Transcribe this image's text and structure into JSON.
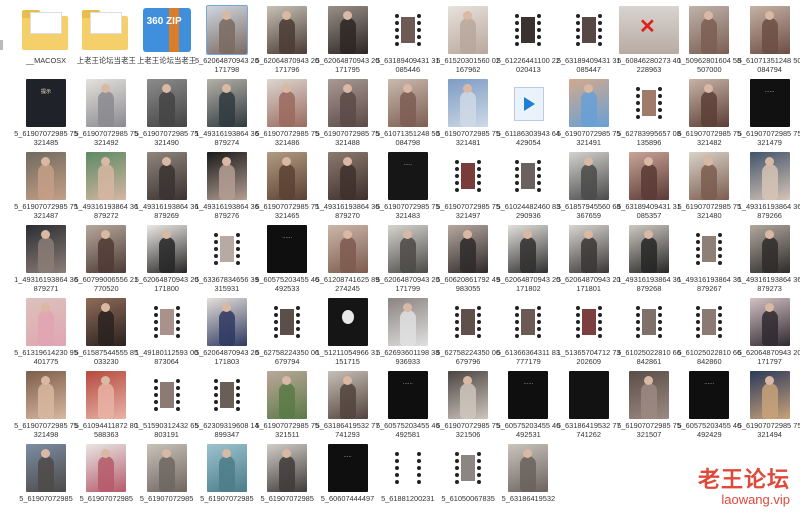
{
  "tiles": [
    {
      "name": "__MACOSX",
      "kind": "folder"
    },
    {
      "name": "上老王论坛当老王",
      "kind": "folder"
    },
    {
      "name": "上老王论坛当老王",
      "kind": "zip",
      "badge": "360 ZIP"
    },
    {
      "name": "5_62064870943 20171798",
      "kind": "photo",
      "c1": "#cfd6e0",
      "c2": "#7a6a62",
      "selected": true
    },
    {
      "name": "5_62064870943 20171796",
      "kind": "photo",
      "c1": "#c7c1b4",
      "c2": "#4a3b34"
    },
    {
      "name": "5_62064870943 20171795",
      "kind": "photo",
      "c1": "#9a8f88",
      "c2": "#2b2624"
    },
    {
      "name": "5_63189409431 31085446",
      "kind": "film",
      "c1": "#6e5a54"
    },
    {
      "name": "5_61520301560 02167962",
      "kind": "photo",
      "c1": "#e7e2dc",
      "c2": "#b9a79c"
    },
    {
      "name": "5_61226441100 22020413",
      "kind": "film",
      "c1": "#3b3332"
    },
    {
      "name": "5_63189409431 31085447",
      "kind": "film",
      "c1": "#574845"
    },
    {
      "name": "5_60846280273 40228963",
      "kind": "redx",
      "c1": "#d8d4d0"
    },
    {
      "name": "1_50962801604 58507000",
      "kind": "photo",
      "c1": "#bfb3aa",
      "c2": "#7b5e52"
    },
    {
      "name": "5_61071351248 50084794",
      "kind": "photo",
      "c1": "#c6b1a4",
      "c2": "#6c4e44"
    },
    {
      "name": "5_61907072985 75321485",
      "kind": "text",
      "c1": "#1f2329",
      "text": "提示"
    },
    {
      "name": "5_61907072985 75321492",
      "kind": "photo",
      "c1": "#e4e1dc",
      "c2": "#8b8a8f"
    },
    {
      "name": "5_61907072985 75321490",
      "kind": "photo",
      "c1": "#8d8c8c",
      "c2": "#444"
    },
    {
      "name": "1_49316193864 36879274",
      "kind": "photo",
      "c1": "#b5b0a8",
      "c2": "#2f3a3f"
    },
    {
      "name": "5_61907072985 75321486",
      "kind": "photo",
      "c1": "#ddd6cf",
      "c2": "#9a6a5f"
    },
    {
      "name": "5_61907072985 75321488",
      "kind": "photo",
      "c1": "#a99993",
      "c2": "#5b4a46"
    },
    {
      "name": "5_61071351248 50084798",
      "kind": "photo",
      "c1": "#cab9ad",
      "c2": "#7d5d52"
    },
    {
      "name": "5_61907072985 75321481",
      "kind": "photo",
      "c1": "#7c9bc4",
      "c2": "#cfd9e6"
    },
    {
      "name": "5_61186303943 64429054",
      "kind": "play"
    },
    {
      "name": "5_61907072985 75321491",
      "kind": "photo",
      "c1": "#d2a98d",
      "c2": "#67a0d6"
    },
    {
      "name": "5_62783995657 08135896",
      "kind": "film",
      "c1": "#a07a6a"
    },
    {
      "name": "5_61907072985 75321482",
      "kind": "photo",
      "c1": "#c7b2a6",
      "c2": "#5c3f37"
    },
    {
      "name": "5_61907072985 75321479",
      "kind": "text",
      "c1": "#111",
      "text": "······"
    },
    {
      "name": "5_61907072985 75321487",
      "kind": "photo",
      "c1": "#6f6a5f",
      "c2": "#c59f86"
    },
    {
      "name": "1_49316193864 36879272",
      "kind": "photo",
      "c1": "#5c8a63",
      "c2": "#d6b6a2"
    },
    {
      "name": "1_49316193864 36879269",
      "kind": "photo",
      "c1": "#8f857c",
      "c2": "#3b3331"
    },
    {
      "name": "1_49316193864 36879276",
      "kind": "photo",
      "c1": "#1a1a1a",
      "c2": "#b39d93"
    },
    {
      "name": "5_61907072985 75321465",
      "kind": "photo",
      "c1": "#b29a82",
      "c2": "#5b4234"
    },
    {
      "name": "1_49316193864 36879270",
      "kind": "photo",
      "c1": "#8b7a6f",
      "c2": "#3e302c"
    },
    {
      "name": "5_61907072985 75321483",
      "kind": "text",
      "c1": "#161616",
      "text": "·····"
    },
    {
      "name": "5_61907072985 75321497",
      "kind": "film",
      "c1": "#7a3b3b"
    },
    {
      "name": "5_61024482460 83290936",
      "kind": "film",
      "c1": "#6a625f"
    },
    {
      "name": "5_61857945560 68367659",
      "kind": "photo",
      "c1": "#d4d2cf",
      "c2": "#4a4a4a"
    },
    {
      "name": "5_63189409431 31085357",
      "kind": "photo",
      "c1": "#c9a497",
      "c2": "#5a3a35"
    },
    {
      "name": "5_61907072985 75321480",
      "kind": "photo",
      "c1": "#dad2c8",
      "c2": "#7b5d4f"
    },
    {
      "name": "1_49316193864 36879266",
      "kind": "photo",
      "c1": "#42546b",
      "c2": "#d6c4b6"
    },
    {
      "name": "1_49316193864 36879271",
      "kind": "photo",
      "c1": "#2b2d33",
      "c2": "#8b7d76"
    },
    {
      "name": "5_60799006556 21770520",
      "kind": "photo",
      "c1": "#b6a79b",
      "c2": "#4d3b35"
    },
    {
      "name": "5_62064870943 20171800",
      "kind": "photo",
      "c1": "#ece8e4",
      "c2": "#262626"
    },
    {
      "name": "5_63367834656 39315931",
      "kind": "film",
      "c1": "#b7a9a3"
    },
    {
      "name": "5_60575203455 46492533",
      "kind": "text",
      "c1": "#0f0f0f",
      "text": "······"
    },
    {
      "name": "5_61208741625 89274245",
      "kind": "photo",
      "c1": "#cbb7aa",
      "c2": "#7c5b4d"
    },
    {
      "name": "5_62064870943 20171799",
      "kind": "photo",
      "c1": "#d7d4cf",
      "c2": "#4c4a47"
    },
    {
      "name": "5_60620861792 49983055",
      "kind": "photo",
      "c1": "#b7a8a0",
      "c2": "#2e2a2a"
    },
    {
      "name": "5_62064870943 20171802",
      "kind": "photo",
      "c1": "#e3e0dc",
      "c2": "#2f2f2f"
    },
    {
      "name": "5_62064870943 20171801",
      "kind": "photo",
      "c1": "#d9d6d2",
      "c2": "#3a3636"
    },
    {
      "name": "1_49316193864 36879268",
      "kind": "photo",
      "c1": "#cfc9c1",
      "c2": "#262626"
    },
    {
      "name": "1_49316193864 36879267",
      "kind": "film",
      "c1": "#8e8077"
    },
    {
      "name": "1_49316193864 36879273",
      "kind": "photo",
      "c1": "#b1a89e",
      "c2": "#2e2b2a"
    },
    {
      "name": "5_61319614230 95401775",
      "kind": "photo",
      "c1": "#dcc2bb",
      "c2": "#e0a5b2"
    },
    {
      "name": "5_61587544555 85033230",
      "kind": "photo",
      "c1": "#8f6b58",
      "c2": "#2a2220"
    },
    {
      "name": "1_49180112593 00873064",
      "kind": "film",
      "c1": "#a9928b"
    },
    {
      "name": "5_62064870943 20171803",
      "kind": "photo",
      "c1": "#e4dfd9",
      "c2": "#2f3a62"
    },
    {
      "name": "5_62758224350 06679794",
      "kind": "film",
      "c1": "#5c4e4a"
    },
    {
      "name": "1_51211054966 31151715",
      "kind": "mask",
      "c1": "#151515"
    },
    {
      "name": "5_62693601198 38936933",
      "kind": "photo",
      "c1": "#8a8380",
      "c2": "#e0e0e0"
    },
    {
      "name": "5_62758224350 06679796",
      "kind": "film",
      "c1": "#5f504b"
    },
    {
      "name": "5_61366364311 83777179",
      "kind": "film",
      "c1": "#6c5a54"
    },
    {
      "name": "1_51365704712 73202609",
      "kind": "film",
      "c1": "#7b3f3f"
    },
    {
      "name": "5_61025022810 66842861",
      "kind": "film",
      "c1": "#7f7069"
    },
    {
      "name": "5_61025022810 66842860",
      "kind": "film",
      "c1": "#8a7a73"
    },
    {
      "name": "5_62064870943 20171797",
      "kind": "photo",
      "c1": "#d3c0c4",
      "c2": "#2f2a30"
    },
    {
      "name": "5_61907072985 75321498",
      "kind": "photo",
      "c1": "#7b5e4a",
      "c2": "#d9b7a0"
    },
    {
      "name": "5_61094411872 80588363",
      "kind": "photo",
      "c1": "#b64a3e",
      "c2": "#e7b3a6"
    },
    {
      "name": "1_51590312432 65803191",
      "kind": "film",
      "c1": "#8c7b74"
    },
    {
      "name": "5_62309319608 14899347",
      "kind": "film",
      "c1": "#6a5e59"
    },
    {
      "name": "5_61907072985 75321511",
      "kind": "photo",
      "c1": "#bba89a",
      "c2": "#5a7a47"
    },
    {
      "name": "5_63186419532 77741293",
      "kind": "photo",
      "c1": "#c7c0b6",
      "c2": "#52433d"
    },
    {
      "name": "5_60575203455 46492581",
      "kind": "text",
      "c1": "#0f0f0f",
      "text": "······"
    },
    {
      "name": "5_61907072985 75321506",
      "kind": "photo",
      "c1": "#4b4542",
      "c2": "#cfc5bd"
    },
    {
      "name": "5_60575203455 46492531",
      "kind": "text",
      "c1": "#0f0f0f",
      "text": "······"
    },
    {
      "name": "5_63186419532 77741262",
      "kind": "text",
      "c1": "#121212",
      "text": ""
    },
    {
      "name": "5_61907072985 75321507",
      "kind": "photo",
      "c1": "#5a4d47",
      "c2": "#9b8a82"
    },
    {
      "name": "5_60575203455 46492429",
      "kind": "text",
      "c1": "#0f0f0f",
      "text": "······"
    },
    {
      "name": "5_61907072985 75321494",
      "kind": "photo",
      "c1": "#2c3a5a",
      "c2": "#c8a27a"
    },
    {
      "name": "5_61907072985",
      "kind": "photo",
      "c1": "#7c8da3",
      "c2": "#4d4a48"
    },
    {
      "name": "5_61907072985",
      "kind": "photo",
      "c1": "#e8e6e3",
      "c2": "#b55a6a"
    },
    {
      "name": "5_61907072985",
      "kind": "photo",
      "c1": "#c8c2b9",
      "c2": "#6f6660"
    },
    {
      "name": "5_61907072985",
      "kind": "photo",
      "c1": "#9cc2cf",
      "c2": "#4b7c88"
    },
    {
      "name": "5_61907072985",
      "kind": "photo",
      "c1": "#d1cdc7",
      "c2": "#3f3b39"
    },
    {
      "name": "5_60607444497",
      "kind": "text",
      "c1": "#0f0f0f",
      "text": "·····"
    },
    {
      "name": "5_61881200231",
      "kind": "film",
      "c1": "#ffffff"
    },
    {
      "name": "5_61050067835",
      "kind": "film",
      "c1": "#8d8582"
    },
    {
      "name": "5_63186419532",
      "kind": "photo",
      "c1": "#cbc4bd",
      "c2": "#6b625d"
    }
  ],
  "watermark": {
    "title": "老王论坛",
    "url": "laowang.vip",
    "color": "#e0483a"
  }
}
